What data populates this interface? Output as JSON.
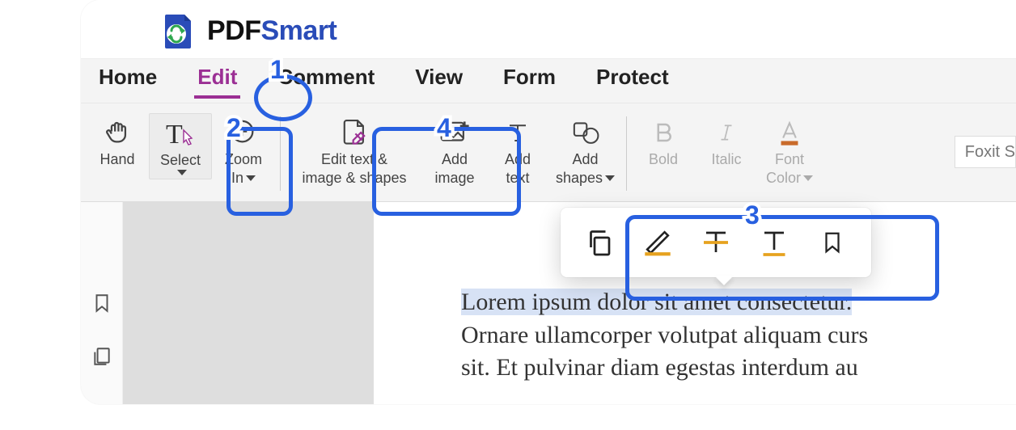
{
  "brand": {
    "bold": "PDF",
    "accent": "Smart"
  },
  "tabs": {
    "home": "Home",
    "edit": "Edit",
    "comment": "Comment",
    "view": "View",
    "form": "Form",
    "protect": "Protect"
  },
  "ribbon": {
    "hand": "Hand",
    "select": "Select",
    "zoom_in_l1": "Zoom",
    "zoom_in_l2": "In",
    "edit_l1": "Edit text &",
    "edit_l2": "image & shapes",
    "add_image_l1": "Add",
    "add_image_l2": "image",
    "add_text_l1": "Add",
    "add_text_l2": "text",
    "add_shapes_l1": "Add",
    "add_shapes_l2": "shapes",
    "bold": "Bold",
    "italic": "Italic",
    "font_color_l1": "Font",
    "font_color_l2": "Color",
    "font_name": "Foxit S"
  },
  "document": {
    "line1": "Lorem ipsum dolor sit amet consectetur.",
    "line2": "Ornare ullamcorper volutpat aliquam curs",
    "line3": "sit. Et pulvinar diam egestas interdum au"
  },
  "annotations": {
    "n1": "1",
    "n2": "2",
    "n3": "3",
    "n4": "4"
  }
}
